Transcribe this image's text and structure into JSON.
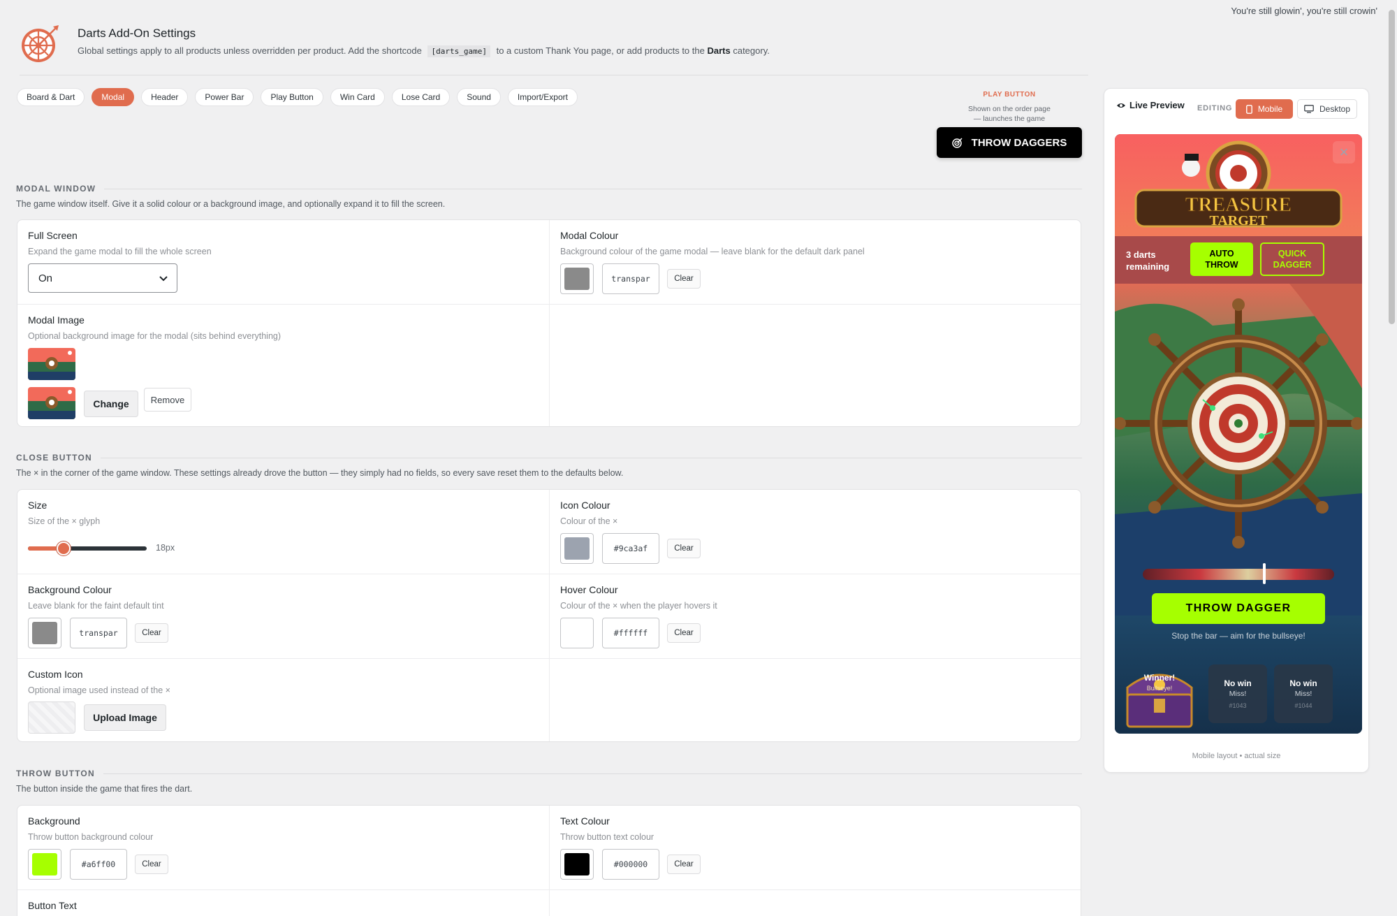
{
  "top_note": "You're still glowin', you're still crowin'",
  "header": {
    "title": "Darts Add-On Settings",
    "subtitle_pre": "Global settings apply to all products unless overridden per product. Add the shortcode",
    "shortcode": "[darts_game]",
    "subtitle_mid": "to a custom Thank You page, or add products to the",
    "subtitle_bold": "Darts",
    "subtitle_post": "category."
  },
  "tabs": [
    "Board & Dart",
    "Modal",
    "Header",
    "Power Bar",
    "Play Button",
    "Win Card",
    "Lose Card",
    "Sound",
    "Import/Export"
  ],
  "active_tab": "Modal",
  "play_button": {
    "label": "PLAY BUTTON",
    "desc_line1": "Shown on the order page",
    "desc_line2": "— launches the game",
    "button_text": "THROW DAGGERS"
  },
  "modal_window": {
    "title": "MODAL WINDOW",
    "desc": "The game window itself. Give it a solid colour or a background image, and optionally expand it to fill the screen.",
    "full_screen": {
      "label": "Full Screen",
      "help": "Expand the game modal to fill the whole screen",
      "value": "On"
    },
    "modal_colour": {
      "label": "Modal Colour",
      "help": "Background colour of the game modal — leave blank for the default dark panel",
      "value": "transpar",
      "swatch": "#8a8a8a",
      "clear": "Clear"
    },
    "modal_image": {
      "label": "Modal Image",
      "help": "Optional background image for the modal (sits behind everything)",
      "change": "Change",
      "remove": "Remove"
    }
  },
  "close_button": {
    "title": "CLOSE BUTTON",
    "desc": "The × in the corner of the game window. These settings already drove the button — they simply had no fields, so every save reset them to the defaults below.",
    "size": {
      "label": "Size",
      "help": "Size of the × glyph",
      "value": "18px",
      "fraction": 0.3
    },
    "icon_colour": {
      "label": "Icon Colour",
      "help": "Colour of the ×",
      "value": "#9ca3af",
      "swatch": "#9ca3af",
      "clear": "Clear"
    },
    "background_colour": {
      "label": "Background Colour",
      "help": "Leave blank for the faint default tint",
      "value": "transpar",
      "swatch": "#8a8a8a",
      "clear": "Clear"
    },
    "hover_colour": {
      "label": "Hover Colour",
      "help": "Colour of the × when the player hovers it",
      "value": "#ffffff",
      "swatch": "#ffffff",
      "clear": "Clear"
    },
    "custom_icon": {
      "label": "Custom Icon",
      "help": "Optional image used instead of the ×",
      "upload": "Upload Image"
    }
  },
  "throw_button": {
    "title": "THROW BUTTON",
    "desc": "The button inside the game that fires the dart.",
    "background": {
      "label": "Background",
      "help": "Throw button background colour",
      "value": "#a6ff00",
      "swatch": "#a6ff00",
      "clear": "Clear"
    },
    "text_colour": {
      "label": "Text Colour",
      "help": "Throw button text colour",
      "value": "#000000",
      "swatch": "#000000",
      "clear": "Clear"
    },
    "button_text": {
      "label": "Button Text"
    }
  },
  "preview": {
    "title": "Live Preview",
    "editing": "EDITING",
    "mobile": "Mobile",
    "desktop": "Desktop",
    "footer": "Mobile layout • actual size",
    "game": {
      "close_glyph": "×",
      "logo_line1": "TREASURE",
      "logo_line2": "TARGET",
      "darts_remaining_1": "3 darts",
      "darts_remaining_2": "remaining",
      "auto_throw_1": "AUTO",
      "auto_throw_2": "THROW",
      "quick_dagger_1": "QUICK",
      "quick_dagger_2": "DAGGER",
      "throw_button": "THROW DAGGER",
      "hint": "Stop the bar — aim for the bullseye!",
      "winner_1": "Winner!",
      "winner_2": "Bullseye!",
      "cards": [
        {
          "title": "No win",
          "sub": "Miss!",
          "id": "#1043"
        },
        {
          "title": "No win",
          "sub": "Miss!",
          "id": "#1044"
        }
      ]
    }
  }
}
